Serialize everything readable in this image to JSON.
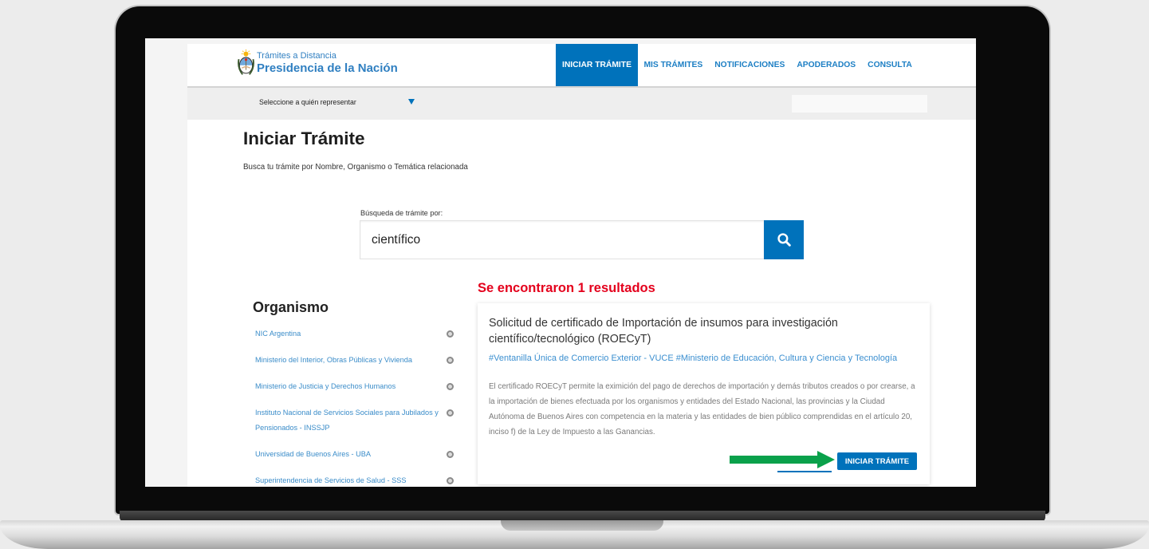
{
  "colors": {
    "primary_blue": "#0072bb",
    "link_blue": "#3a8cc9",
    "results_red": "#e4001c",
    "arrow_green": "#0aa14b",
    "subbar_gray": "#eeeeee"
  },
  "header": {
    "logo_icon": "coat-of-arms-icon",
    "logo_line1": "Trámites a Distancia",
    "logo_line2": "Presidencia de la Nación",
    "nav": [
      {
        "label": "INICIAR TRÁMITE",
        "active": true
      },
      {
        "label": "MIS TRÁMITES",
        "active": false
      },
      {
        "label": "NOTIFICACIONES",
        "active": false
      },
      {
        "label": "APODERADOS",
        "active": false
      },
      {
        "label": "CONSULTA",
        "active": false
      }
    ]
  },
  "subbar": {
    "represent_label": "Seleccione a quién representar",
    "represent_icon": "triangle-down-icon"
  },
  "main": {
    "title": "Iniciar Trámite",
    "subtitle": "Busca tu trámite por Nombre, Organismo o Temática relacionada",
    "search": {
      "label": "Búsqueda de trámite por:",
      "value": "científico",
      "button_icon": "search-icon"
    },
    "results_summary": "Se encontraron 1 resultados"
  },
  "sidebar": {
    "heading": "Organismo",
    "bullet_icon": "circle-bullet-icon",
    "items": [
      {
        "label": "NIC Argentina"
      },
      {
        "label": "Ministerio del Interior, Obras Públicas y Vivienda"
      },
      {
        "label": "Ministerio de Justicia y Derechos Humanos"
      },
      {
        "label": "Instituto Nacional de Servicios Sociales para Jubilados y Pensionados - INSSJP"
      },
      {
        "label": "Universidad de Buenos Aires - UBA"
      },
      {
        "label": "Superintendencia de Servicios de Salud - SSS"
      }
    ]
  },
  "results": [
    {
      "title": "Solicitud de certificado de Importación de insumos para investigación científico/tecnológico (ROECyT)",
      "tags": "#Ventanilla Única de Comercio Exterior - VUCE #Ministerio de Educación, Cultura y Ciencia y Tecnología",
      "description": "El certificado ROECyT permite la eximición del pago de derechos de importación y demás tributos creados o por crearse, a la importación de bienes efectuada por los organismos y entidades del Estado Nacional, las provincias y la Ciudad Autónoma de Buenos Aires con competencia en la materia y las entidades de bien público comprendidas en el artículo 20, inciso f) de la Ley de Impuesto a las Ganancias.",
      "button_label": "INICIAR TRÁMITE",
      "pointer_icon": "green-arrow-icon"
    }
  ]
}
